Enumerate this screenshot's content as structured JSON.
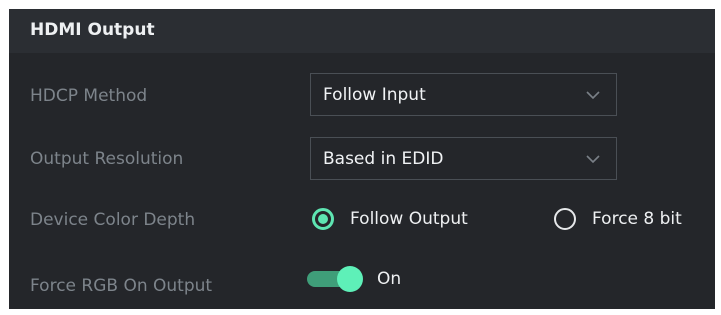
{
  "panel": {
    "title": "HDMI Output"
  },
  "hdcp_method": {
    "label": "HDCP Method",
    "value": "Follow Input",
    "icon": "chevron-down-icon"
  },
  "output_resolution": {
    "label": "Output Resolution",
    "value": "Based in EDID",
    "icon": "chevron-down-icon"
  },
  "device_color_depth": {
    "label": "Device Color Depth",
    "options": [
      {
        "label": "Follow Output",
        "selected": true
      },
      {
        "label": "Force 8 bit",
        "selected": false
      }
    ]
  },
  "force_rgb": {
    "label": "Force RGB On Output",
    "state": "On",
    "enabled": true
  },
  "colors": {
    "panel_background": "#24262a",
    "header_background": "#2b2e33",
    "accent": "#5ee5b2",
    "label_text": "#7d848b",
    "value_text": "#f1f3f5",
    "select_border": "#4a4f55"
  }
}
